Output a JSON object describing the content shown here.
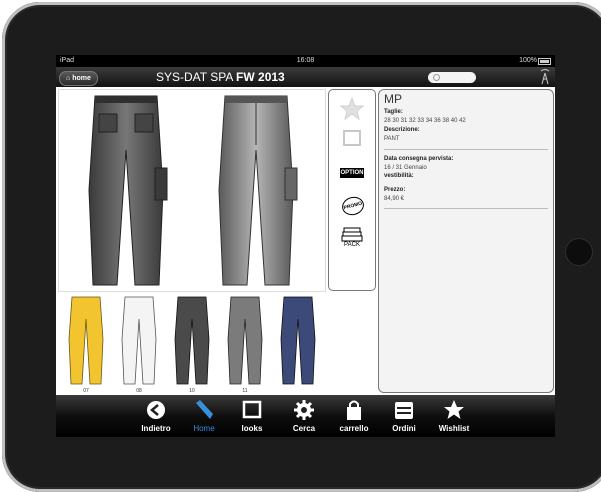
{
  "status_bar": {
    "device": "iPad",
    "time": "16:08",
    "battery": "100%"
  },
  "top_bar": {
    "home_label": "home",
    "brand_name": "SYS-DAT SPA",
    "season": "FW 2013"
  },
  "sidebar_actions": {
    "option_label": "OPTION",
    "promo_label": "PROMO",
    "pack_label": "PACK"
  },
  "thumbnails": [
    {
      "code": "07",
      "color": "#f2c430"
    },
    {
      "code": "08",
      "color": "#f4f4f4"
    },
    {
      "code": "10",
      "color": "#4a4a4a"
    },
    {
      "code": "11",
      "color": "#7b7b7b"
    },
    {
      "code": "",
      "color": "#3b4a78"
    }
  ],
  "product": {
    "code": "MP",
    "sizes_label": "Taglie:",
    "sizes": "28 30 31 32 33 34 36 38 40 42",
    "description_label": "Descrizione:",
    "description": "PANT",
    "delivery_label": "Data consegna pervista:",
    "delivery": "16 / 31 Gennaio",
    "fit_label": "vestibilità:",
    "fit": "",
    "price_label": "Prezzo:",
    "price": "84,90 €"
  },
  "tabs": [
    {
      "label": "Indietro",
      "icon": "back-icon"
    },
    {
      "label": "Home",
      "icon": "home-tab-icon",
      "active": true
    },
    {
      "label": "looks",
      "icon": "looks-icon"
    },
    {
      "label": "Cerca",
      "icon": "gear-icon"
    },
    {
      "label": "carrello",
      "icon": "shopping-bag-icon"
    },
    {
      "label": "Ordini",
      "icon": "orders-icon"
    },
    {
      "label": "Wishlist",
      "icon": "star-icon"
    }
  ],
  "colors": {
    "active_tab": "#3a8fd9",
    "hero_denim": "#555555"
  }
}
